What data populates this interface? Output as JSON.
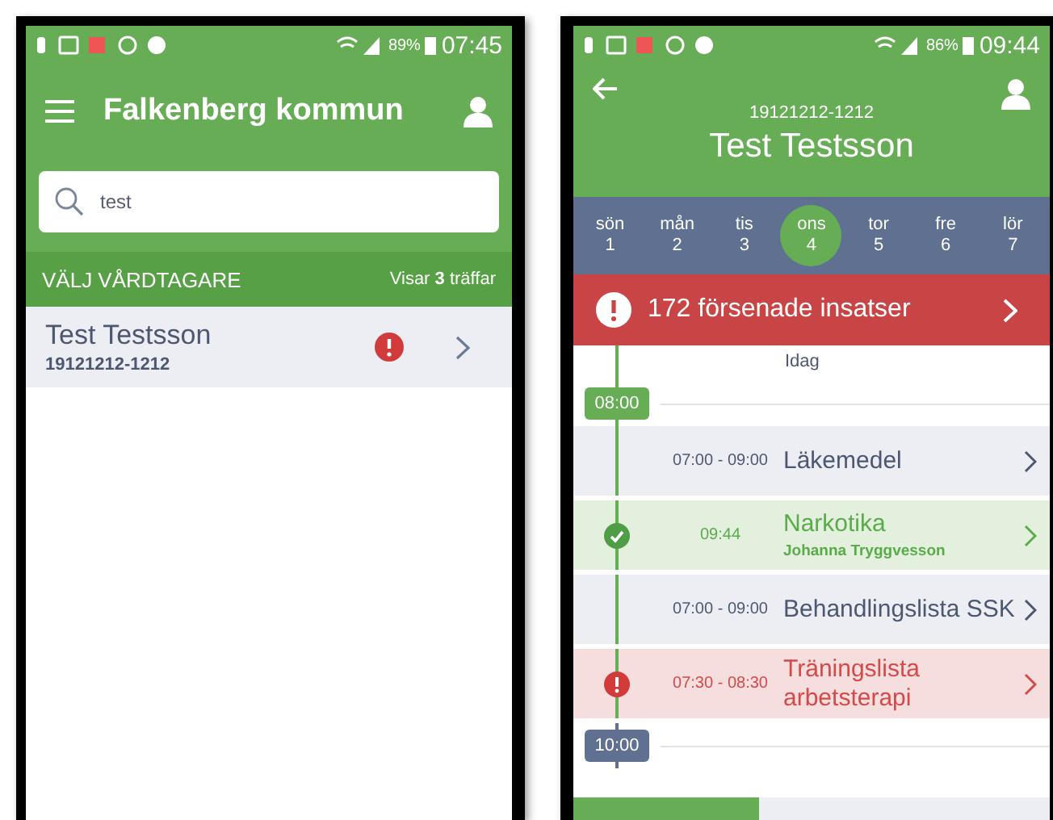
{
  "search_screen": {
    "status_bar": {
      "battery": "89%",
      "time": "07:45"
    },
    "app_bar": {
      "title": "Falkenberg kommun"
    },
    "search": {
      "value": "test"
    },
    "list_header": {
      "title": "VÄLJ VÅRDTAGARE",
      "count": "Visar **3** träffar"
    },
    "patients": [
      {
        "name": "Test Testsson",
        "id": "19121212-1212",
        "alert": true
      }
    ]
  },
  "schedule_screen": {
    "status_bar": {
      "battery": "86%",
      "time": "09:44"
    },
    "header": {
      "id": "19121212-1212",
      "name": "Test Testsson"
    },
    "days": [
      {
        "name": "sön",
        "date": "1",
        "selected": false
      },
      {
        "name": "mån",
        "date": "2",
        "selected": false
      },
      {
        "name": "tis",
        "date": "3",
        "selected": false
      },
      {
        "name": "ons",
        "date": "4",
        "selected": true
      },
      {
        "name": "tor",
        "date": "5",
        "selected": false
      },
      {
        "name": "fre",
        "date": "6",
        "selected": false
      },
      {
        "name": "lör",
        "date": "7",
        "selected": false
      }
    ],
    "delayed_banner": {
      "text": "172 försenade insatser"
    },
    "timeline": {
      "day_label": "Idag",
      "items": [
        {
          "kind": "time",
          "label": "08:00",
          "past": true
        },
        {
          "kind": "task",
          "done": false,
          "overdue": false,
          "time": "07:00 - 09:00",
          "title": "Läkemedel"
        },
        {
          "kind": "task",
          "done": true,
          "overdue": false,
          "time": "09:44",
          "title": "Narkotika",
          "signed_by": "Johanna Tryggvesson"
        },
        {
          "kind": "task",
          "done": false,
          "overdue": false,
          "time": "07:00 - 09:00",
          "title": "Behandlingslista SSK"
        },
        {
          "kind": "task",
          "done": false,
          "overdue": true,
          "time": "07:30 - 08:30",
          "title": "Träningslista arbetsterapi"
        },
        {
          "kind": "time",
          "label": "10:00",
          "past": false
        }
      ]
    }
  }
}
